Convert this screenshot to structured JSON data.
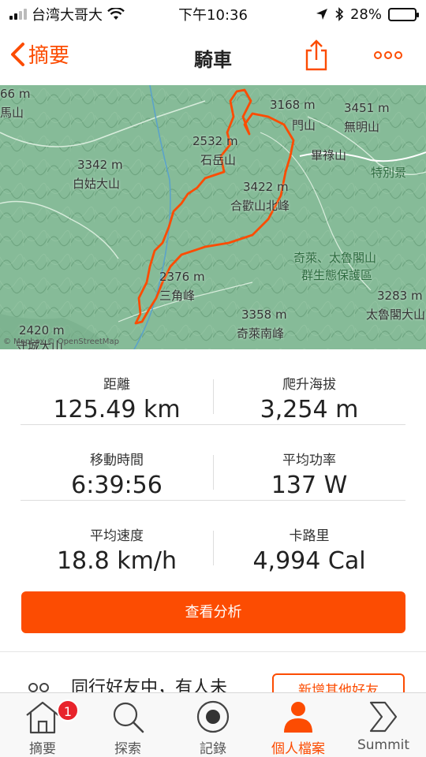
{
  "status_bar": {
    "carrier": "台湾大哥大",
    "time": "下午10:36",
    "battery_percent": "28%",
    "battery_level": 0.28
  },
  "nav": {
    "back_label": "摘要",
    "title": "騎車"
  },
  "map": {
    "labels": [
      {
        "text": "66 m",
        "kind": "elev"
      },
      {
        "text": "馬山",
        "kind": "peak"
      },
      {
        "text": "3168 m",
        "kind": "elev"
      },
      {
        "text": "3451 m",
        "kind": "elev"
      },
      {
        "text": "門山",
        "kind": "peak"
      },
      {
        "text": "無明山",
        "kind": "peak"
      },
      {
        "text": "2532 m",
        "kind": "elev"
      },
      {
        "text": "石岳山",
        "kind": "peak"
      },
      {
        "text": "畢祿山",
        "kind": "peak"
      },
      {
        "text": "3342 m",
        "kind": "elev"
      },
      {
        "text": "白姑大山",
        "kind": "peak"
      },
      {
        "text": "3422 m",
        "kind": "elev"
      },
      {
        "text": "合歡山北峰",
        "kind": "peak"
      },
      {
        "text": "特別景",
        "kind": "green"
      },
      {
        "text": "奇萊、太魯閣山",
        "kind": "green"
      },
      {
        "text": "群生態保護區",
        "kind": "green"
      },
      {
        "text": "2376 m",
        "kind": "elev"
      },
      {
        "text": "三角峰",
        "kind": "peak"
      },
      {
        "text": "3283 m",
        "kind": "elev"
      },
      {
        "text": "太魯閣大山",
        "kind": "peak"
      },
      {
        "text": "3358 m",
        "kind": "elev"
      },
      {
        "text": "奇萊南峰",
        "kind": "peak"
      },
      {
        "text": "2420 m",
        "kind": "elev"
      },
      {
        "text": "守城大山",
        "kind": "peak"
      }
    ],
    "attribution": "© Mapbox © OpenStreetMap",
    "route_color": "#fc4c02"
  },
  "stats": [
    {
      "label": "距離",
      "value": "125.49 km"
    },
    {
      "label": "爬升海拔",
      "value": "3,254 m"
    },
    {
      "label": "移動時間",
      "value": "6:39:56"
    },
    {
      "label": "平均功率",
      "value": "137 W"
    },
    {
      "label": "平均速度",
      "value": "18.8 km/h"
    },
    {
      "label": "卡路里",
      "value": "4,994 Cal"
    }
  ],
  "analyze_button": "查看分析",
  "friend_prompt": {
    "text": "同行好友中，有人未",
    "button": "新增其他好友"
  },
  "tabs": [
    {
      "label": "摘要",
      "icon": "home-icon",
      "badge": "1"
    },
    {
      "label": "探索",
      "icon": "search-icon"
    },
    {
      "label": "記錄",
      "icon": "record-icon"
    },
    {
      "label": "個人檔案",
      "icon": "profile-icon",
      "active": true
    },
    {
      "label": "Summit",
      "icon": "summit-icon"
    }
  ],
  "colors": {
    "accent": "#fc4c02",
    "badge": "#e8232b"
  }
}
